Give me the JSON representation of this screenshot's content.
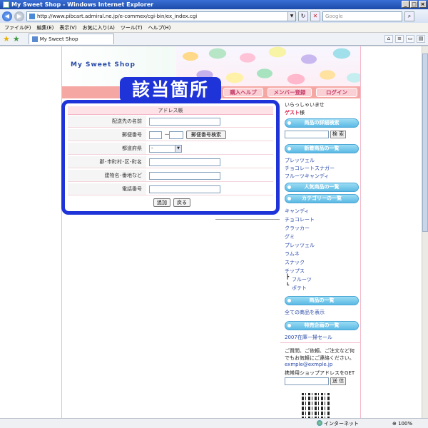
{
  "window": {
    "title": "My Sweet Shop - Windows Internet Explorer",
    "minimize": "_",
    "maximize": "□",
    "close": "×"
  },
  "address_bar": {
    "url": "http://www.pibcart.admiral.ne.jp/e-commex/cgi-bin/ex_index.cgi",
    "search_placeholder": "Google",
    "back": "◀",
    "forward": "▶",
    "refresh": "↻",
    "stop": "✕",
    "search": "⌕"
  },
  "menu": [
    "ファイル(F)",
    "編集(E)",
    "表示(V)",
    "お気に入り(A)",
    "ツール(T)",
    "ヘルプ(H)"
  ],
  "tab": {
    "label": "My Sweet Shop"
  },
  "header": {
    "shop_name": "My Sweet Shop",
    "nav": [
      "購入ヘルプ",
      "メンバー登録",
      "ログイン"
    ]
  },
  "highlight_label": "該当箇所",
  "form": {
    "title": "アドレス帳",
    "rows": [
      {
        "label": "配送先の名前"
      },
      {
        "label": "郵便番号",
        "dash": "－",
        "button": "郵便番号検索"
      },
      {
        "label": "都道府県",
        "select": "-"
      },
      {
        "label": "郡･市町村･区･町名"
      },
      {
        "label": "建物名･番地など"
      },
      {
        "label": "電話番号"
      }
    ],
    "add_button": "追加",
    "back_button": "戻る"
  },
  "sidebar": {
    "greeting": "いらっしゃいませ",
    "guest_name": "ゲスト",
    "guest_suffix": "様",
    "search_pill": "商品の詳細検索",
    "search_button": "検 索",
    "new_items_pill": "新着商品の一覧",
    "new_items": [
      "プレッツェル",
      "チョコレートスナガー",
      "フルーツキャンディ"
    ],
    "popular_pill": "人気商品の一覧",
    "category_pill": "カテゴリーの一覧",
    "categories": [
      "キャンディ",
      "チョコレート",
      "クラッカー",
      "グミ",
      "プレッツェル",
      "ラムネ",
      "スナック",
      "チップス"
    ],
    "sub_categories": [
      "フルーツ",
      "ポテト"
    ],
    "all_items_pill": "商品の一覧",
    "all_items_link": "全ての商品を表示",
    "special_pill": "特売企画の一覧",
    "special_link": "2007在庫一掃セール",
    "contact_text_1": "ご質問、ご依頼、ご注文など何",
    "contact_text_2": "でもお気軽にご連絡ください。",
    "email": "exmple@exmple.jp",
    "mobile_text": "携帯用ショップアドレスをGET",
    "send_button": "送 信"
  },
  "status_bar": {
    "zone": "インターネット",
    "zoom": "100%"
  }
}
